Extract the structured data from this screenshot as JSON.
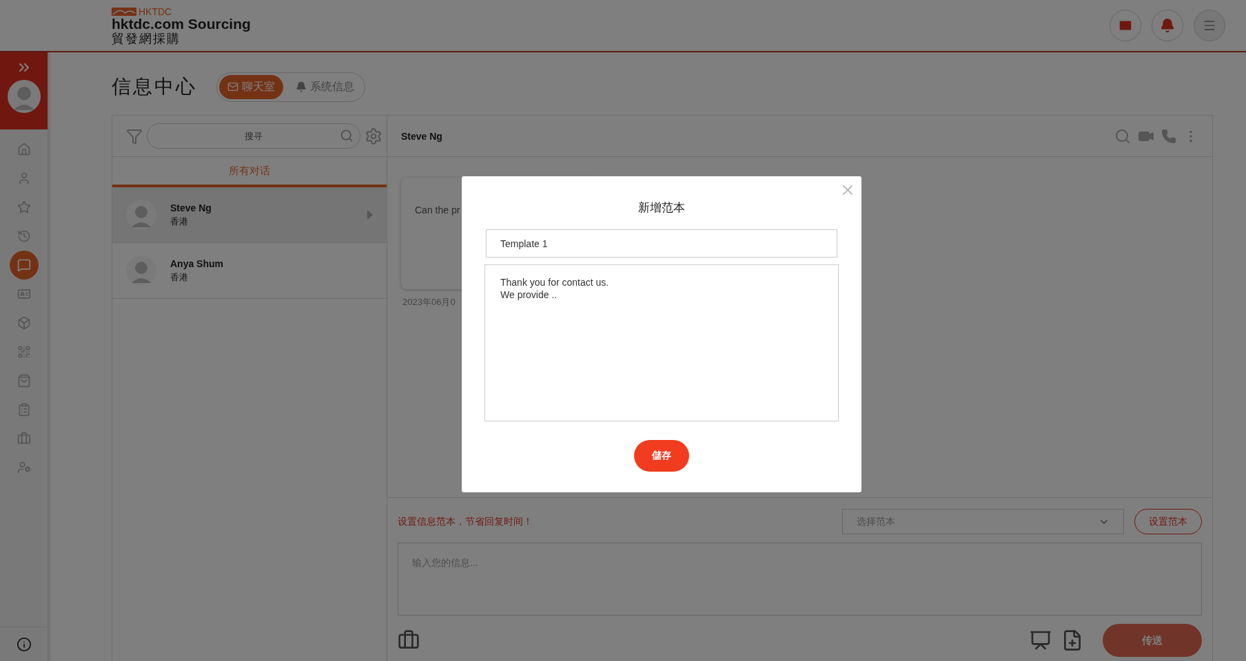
{
  "header": {
    "brand_mark": "HKTDC",
    "title": "hktdc.com Sourcing",
    "subtitle": "貿發網採購"
  },
  "sidebar": {
    "items": [
      {
        "selected": false
      },
      {
        "selected": false
      },
      {
        "selected": false
      },
      {
        "selected": false
      },
      {
        "selected": true
      },
      {
        "selected": false
      },
      {
        "selected": false
      },
      {
        "selected": false
      },
      {
        "selected": false
      },
      {
        "selected": false
      },
      {
        "selected": false
      },
      {
        "selected": false
      }
    ]
  },
  "page": {
    "title": "信息中心",
    "tabs": [
      {
        "label": "聊天室",
        "selected": true
      },
      {
        "label": "系统信息",
        "selected": false
      }
    ]
  },
  "conversations": {
    "search": {
      "placeholder": "搜寻"
    },
    "filter_tab": {
      "label": "所有对话",
      "selected": true
    },
    "items": [
      {
        "name": "Steve Ng",
        "region": "香港",
        "selected": true
      },
      {
        "name": "Anya Shum",
        "region": "香港",
        "selected": false
      }
    ]
  },
  "chat": {
    "contact": "Steve Ng",
    "message": {
      "text": "Can the pr",
      "date": "2023年06月0"
    },
    "template_hint": "设置信息范本，节省回复时间！",
    "template_select": {
      "placeholder": "选择范本"
    },
    "set_template_button": "设置范本",
    "message_field": {
      "placeholder": "输入您的信息..."
    },
    "send_button": {
      "label": "传送",
      "disabled": true
    }
  },
  "dialog": {
    "title": "新增范本",
    "name_field": {
      "value": "Template 1"
    },
    "body_field": {
      "value": "Thank you for contact us.\nWe provide .."
    },
    "save_button": "儲存"
  }
}
